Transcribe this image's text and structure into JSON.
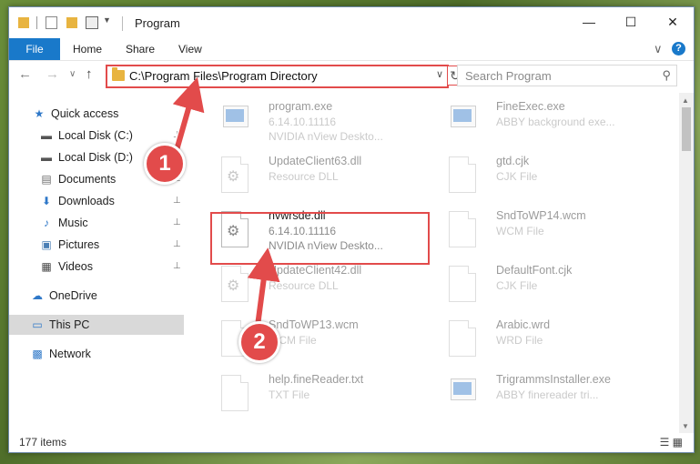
{
  "window": {
    "title": "Program",
    "controls": {
      "minimize": "—",
      "maximize": "☐",
      "close": "✕"
    }
  },
  "ribbon": {
    "tabs": [
      "File",
      "Home",
      "Share",
      "View"
    ],
    "collapse_glyph": "∨",
    "help_glyph": "?"
  },
  "navbar": {
    "back": "←",
    "forward": "→",
    "recent": "∨",
    "up": "↑",
    "address_path": "C:\\Program Files\\Program Directory",
    "address_dropdown": "∨",
    "refresh": "↻",
    "search_placeholder": "Search Program",
    "search_icon": "⚲"
  },
  "nav_pane": {
    "items": [
      {
        "label": "Quick access",
        "icon": "star-icon",
        "glyph": "★",
        "color": "#2f78c8",
        "pinned": false
      },
      {
        "label": "Local Disk (C:)",
        "icon": "drive-icon",
        "glyph": "▬",
        "color": "#555555",
        "pinned": true
      },
      {
        "label": "Local Disk (D:)",
        "icon": "drive-icon",
        "glyph": "▬",
        "color": "#555555",
        "pinned": true
      },
      {
        "label": "Documents",
        "icon": "documents-icon",
        "glyph": "▤",
        "color": "#6b6b6b",
        "pinned": true
      },
      {
        "label": "Downloads",
        "icon": "download-icon",
        "glyph": "⬇",
        "color": "#2f78c8",
        "pinned": true
      },
      {
        "label": "Music",
        "icon": "music-icon",
        "glyph": "♪",
        "color": "#2f78c8",
        "pinned": true
      },
      {
        "label": "Pictures",
        "icon": "pictures-icon",
        "glyph": "▣",
        "color": "#4a7fb5",
        "pinned": true
      },
      {
        "label": "Videos",
        "icon": "videos-icon",
        "glyph": "▦",
        "color": "#444444",
        "pinned": true
      },
      {
        "label": "OneDrive",
        "icon": "cloud-icon",
        "glyph": "☁",
        "color": "#2f78c8",
        "pinned": false
      },
      {
        "label": "This PC",
        "icon": "computer-icon",
        "glyph": "▭",
        "color": "#2f78c8",
        "pinned": false,
        "selected": true
      },
      {
        "label": "Network",
        "icon": "network-icon",
        "glyph": "▩",
        "color": "#2f78c8",
        "pinned": false
      }
    ],
    "pin_glyph": "📌"
  },
  "files": [
    {
      "name": "program.exe",
      "line2": "6.14.10.11116",
      "line3": "NVIDIA nView Deskto...",
      "kind": "exe",
      "dim": true
    },
    {
      "name": "FineExec.exe",
      "line2": "ABBY background exe...",
      "line3": "",
      "kind": "exe",
      "dim": true
    },
    {
      "name": "UpdateClient63.dll",
      "line2": "Resource DLL",
      "line3": "",
      "kind": "dll",
      "dim": true
    },
    {
      "name": "gtd.cjk",
      "line2": "CJK File",
      "line3": "",
      "kind": "doc",
      "dim": true
    },
    {
      "name": "nvwrsde.dll",
      "line2": "6.14.10.11116",
      "line3": "NVIDIA nView Deskto...",
      "kind": "dll",
      "dim": false
    },
    {
      "name": "SndToWP14.wcm",
      "line2": "WCM File",
      "line3": "",
      "kind": "doc",
      "dim": true
    },
    {
      "name": "UpdateClient42.dll",
      "line2": "Resource DLL",
      "line3": "",
      "kind": "dll",
      "dim": true
    },
    {
      "name": "DefaultFont.cjk",
      "line2": "CJK File",
      "line3": "",
      "kind": "doc",
      "dim": true
    },
    {
      "name": "SndToWP13.wcm",
      "line2": "WCM File",
      "line3": "",
      "kind": "doc",
      "dim": true
    },
    {
      "name": "Arabic.wrd",
      "line2": "WRD File",
      "line3": "",
      "kind": "doc",
      "dim": true
    },
    {
      "name": "help.fineReader.txt",
      "line2": "TXT File",
      "line3": "",
      "kind": "doc",
      "dim": true
    },
    {
      "name": "TrigrammsInstaller.exe",
      "line2": "ABBY finereader tri...",
      "line3": "",
      "kind": "exe",
      "dim": true
    }
  ],
  "status": {
    "count": "177 items",
    "view_icons": "☰ ▦"
  },
  "annotations": {
    "step1": "1",
    "step2": "2",
    "color": "#e24b4b"
  }
}
